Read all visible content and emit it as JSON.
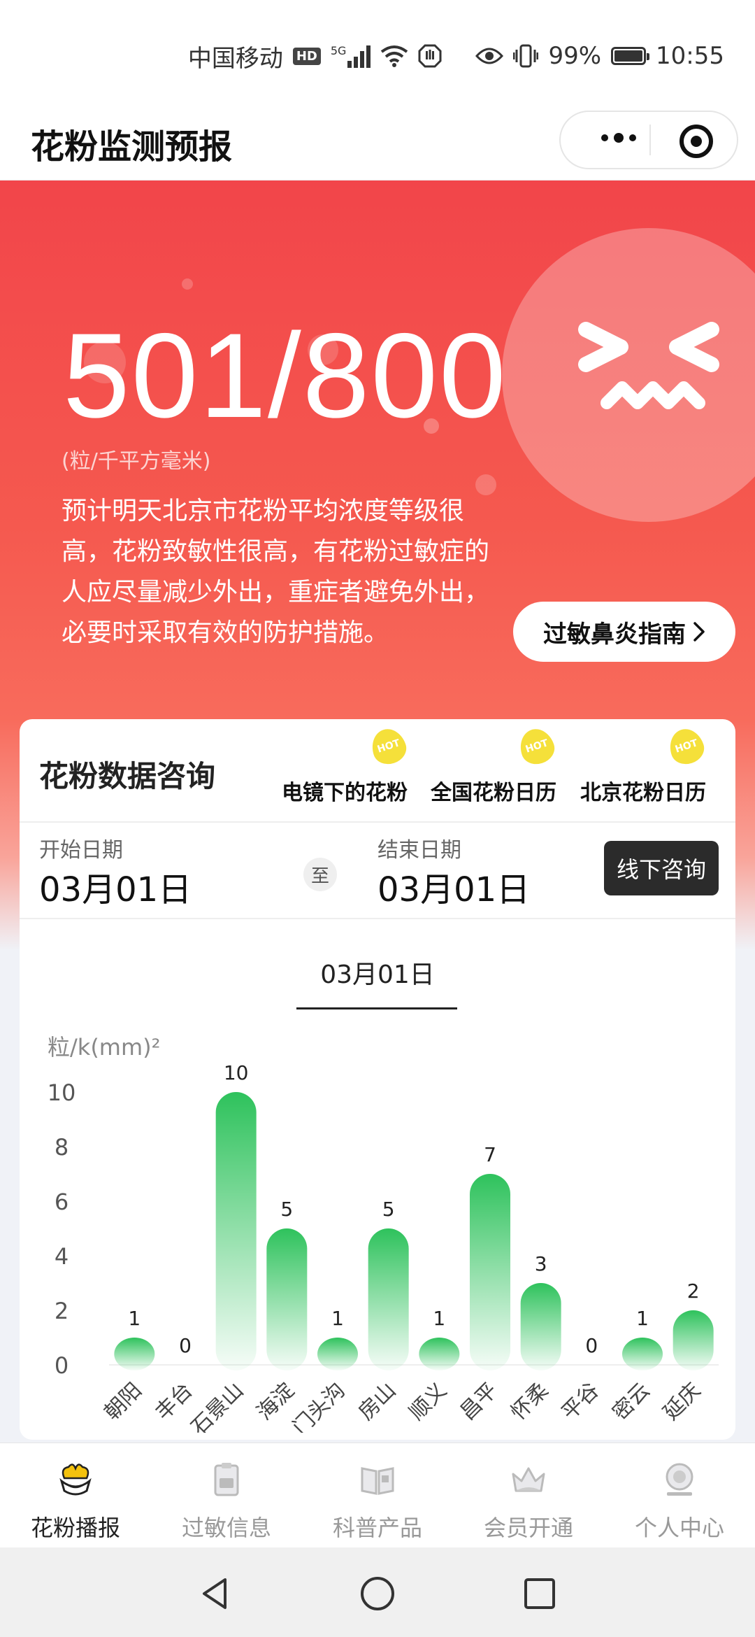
{
  "status_bar": {
    "carrier": "中国移动",
    "hd": "HD",
    "network": "5G",
    "battery": "99%",
    "time": "10:55"
  },
  "app": {
    "title": "花粉监测预报"
  },
  "hero": {
    "value": "501/800",
    "unit": "(粒/千平方毫米)",
    "description": "预计明天北京市花粉平均浓度等级很高，花粉致敏性很高，有花粉过敏症的人应尽量减少外出，重症者避免外出，必要时采取有效的防护措施。",
    "guide_button": "过敏鼻炎指南",
    "accent_color": "#f2454a"
  },
  "query": {
    "title": "花粉数据咨询",
    "links": [
      {
        "label": "电镜下的花粉",
        "badge": "HOT"
      },
      {
        "label": "全国花粉日历",
        "badge": "HOT"
      },
      {
        "label": "北京花粉日历",
        "badge": "HOT"
      }
    ],
    "start_label": "开始日期",
    "start_value": "03月01日",
    "to": "至",
    "end_label": "结束日期",
    "end_value": "03月01日",
    "consult_button": "线下咨询",
    "selected_date": "03月01日"
  },
  "chart_data": {
    "type": "bar",
    "ylabel": "粒/k(mm)²",
    "ylim": [
      0,
      10
    ],
    "yticks": [
      0,
      2,
      4,
      6,
      8,
      10
    ],
    "categories": [
      "朝阳",
      "丰台",
      "石景山",
      "海淀",
      "门头沟",
      "房山",
      "顺义",
      "昌平",
      "怀柔",
      "平谷",
      "密云",
      "延庆"
    ],
    "values": [
      1,
      0,
      10,
      5,
      1,
      5,
      1,
      7,
      3,
      0,
      1,
      2
    ],
    "grid": false,
    "bar_color": "#2ec25c"
  },
  "tabbar": {
    "items": [
      {
        "label": "花粉播报",
        "icon": "flower-icon",
        "active": true
      },
      {
        "label": "过敏信息",
        "icon": "clipboard-icon",
        "active": false
      },
      {
        "label": "科普产品",
        "icon": "book-icon",
        "active": false
      },
      {
        "label": "会员开通",
        "icon": "crown-icon",
        "active": false
      },
      {
        "label": "个人中心",
        "icon": "user-icon",
        "active": false
      }
    ]
  }
}
